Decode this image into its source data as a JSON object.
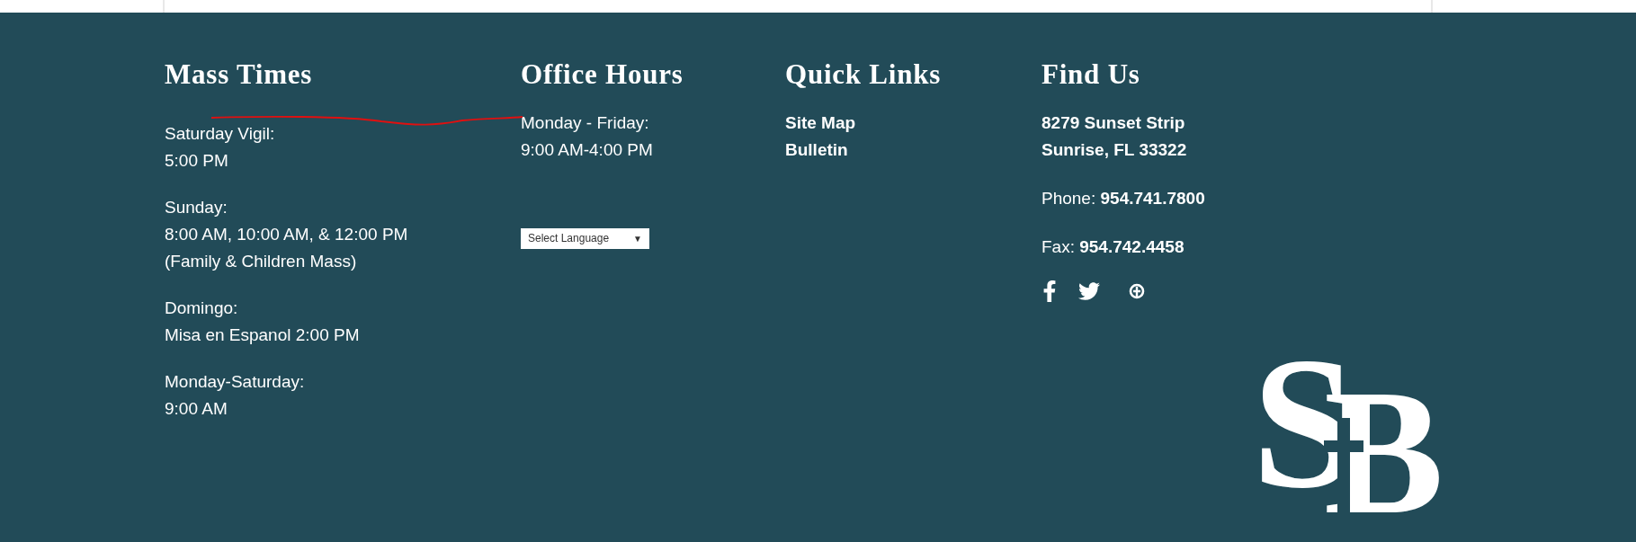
{
  "mass_times": {
    "heading": "Mass Times",
    "blocks": [
      {
        "label": "Saturday Vigil:",
        "times": "5:00 PM"
      },
      {
        "label": "Sunday:",
        "times": "8:00 AM, 10:00 AM, & 12:00 PM (Family & Children Mass)"
      },
      {
        "label": "Domingo:",
        "times": "Misa en Espanol 2:00 PM"
      },
      {
        "label": "Monday-Saturday:",
        "times": "9:00 AM"
      }
    ]
  },
  "office_hours": {
    "heading": "Office Hours",
    "days": "Monday - Friday:",
    "hours": "9:00 AM-4:00 PM",
    "language_select": {
      "value": "Select Language",
      "caret": "▼"
    }
  },
  "quick_links": {
    "heading": "Quick Links",
    "links": [
      "Site Map",
      "Bulletin"
    ]
  },
  "find_us": {
    "heading": "Find Us",
    "address": [
      "8279 Sunset Strip",
      "Sunrise, FL 33322"
    ],
    "contacts": [
      "Phone: **954.741.7800**",
      "Fax: **954.742.4458**"
    ],
    "social": [
      {
        "kind": "facebook"
      },
      {
        "kind": "twitter"
      },
      {
        "kind": "other"
      }
    ]
  },
  "logo": {
    "letters": [
      "S",
      "B"
    ]
  }
}
